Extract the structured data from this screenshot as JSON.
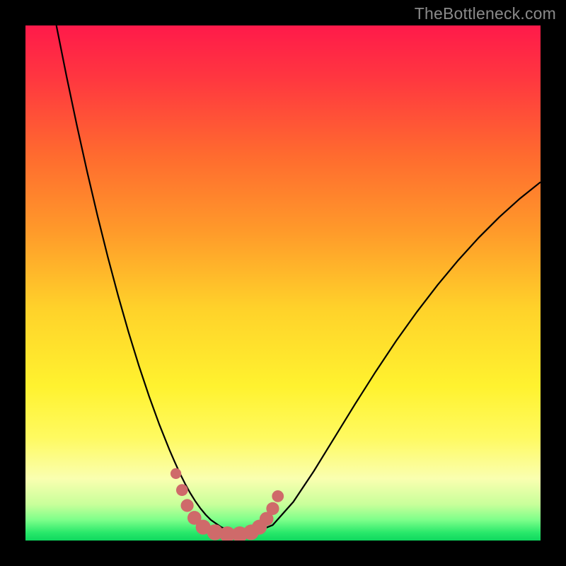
{
  "watermark": "TheBottleneck.com",
  "colors": {
    "frame": "#000000",
    "curve_stroke": "#000000",
    "marker_fill": "#cf6a6a",
    "gradient_stops": [
      {
        "offset": 0.0,
        "color": "#ff1a4a"
      },
      {
        "offset": 0.1,
        "color": "#ff3640"
      },
      {
        "offset": 0.25,
        "color": "#ff6a2f"
      },
      {
        "offset": 0.4,
        "color": "#ff9a2a"
      },
      {
        "offset": 0.55,
        "color": "#ffd22a"
      },
      {
        "offset": 0.7,
        "color": "#fff22f"
      },
      {
        "offset": 0.8,
        "color": "#fffa60"
      },
      {
        "offset": 0.88,
        "color": "#faffb0"
      },
      {
        "offset": 0.93,
        "color": "#c8ff9a"
      },
      {
        "offset": 0.96,
        "color": "#7dff8a"
      },
      {
        "offset": 0.985,
        "color": "#28e86a"
      },
      {
        "offset": 1.0,
        "color": "#0fd85e"
      }
    ]
  },
  "chart_data": {
    "type": "line",
    "title": "",
    "xlabel": "",
    "ylabel": "",
    "xlim": [
      0,
      100
    ],
    "ylim": [
      0,
      100
    ],
    "grid": false,
    "legend": false,
    "series": [
      {
        "name": "bottleneck-curve",
        "x": [
          6,
          8,
          10,
          12,
          14,
          16,
          18,
          20,
          22,
          24,
          26,
          28,
          29,
          30,
          31,
          32,
          33,
          34,
          35,
          36,
          38,
          40,
          44,
          48,
          52,
          56,
          60,
          64,
          68,
          72,
          76,
          80,
          84,
          88,
          92,
          96,
          100
        ],
        "y": [
          100,
          90,
          80.5,
          71.5,
          63,
          55,
          47.5,
          40.5,
          34,
          28,
          22.5,
          17.5,
          15.2,
          13,
          11,
          9.2,
          7.6,
          6.2,
          5.0,
          4.0,
          2.6,
          1.8,
          1.4,
          3.0,
          7.5,
          13.5,
          20,
          26.5,
          32.8,
          38.8,
          44.4,
          49.6,
          54.4,
          58.8,
          62.8,
          66.4,
          69.6
        ]
      }
    ],
    "markers": [
      {
        "x": 29.2,
        "y": 13.0,
        "r": 1.0
      },
      {
        "x": 30.4,
        "y": 9.8,
        "r": 1.2
      },
      {
        "x": 31.4,
        "y": 6.8,
        "r": 1.4
      },
      {
        "x": 32.8,
        "y": 4.4,
        "r": 1.6
      },
      {
        "x": 34.5,
        "y": 2.6,
        "r": 1.8
      },
      {
        "x": 36.8,
        "y": 1.6,
        "r": 2.0
      },
      {
        "x": 39.2,
        "y": 1.2,
        "r": 2.0
      },
      {
        "x": 41.6,
        "y": 1.2,
        "r": 2.0
      },
      {
        "x": 43.8,
        "y": 1.6,
        "r": 1.9
      },
      {
        "x": 45.4,
        "y": 2.6,
        "r": 1.8
      },
      {
        "x": 46.8,
        "y": 4.2,
        "r": 1.6
      },
      {
        "x": 48.0,
        "y": 6.2,
        "r": 1.4
      },
      {
        "x": 49.0,
        "y": 8.6,
        "r": 1.2
      }
    ]
  }
}
